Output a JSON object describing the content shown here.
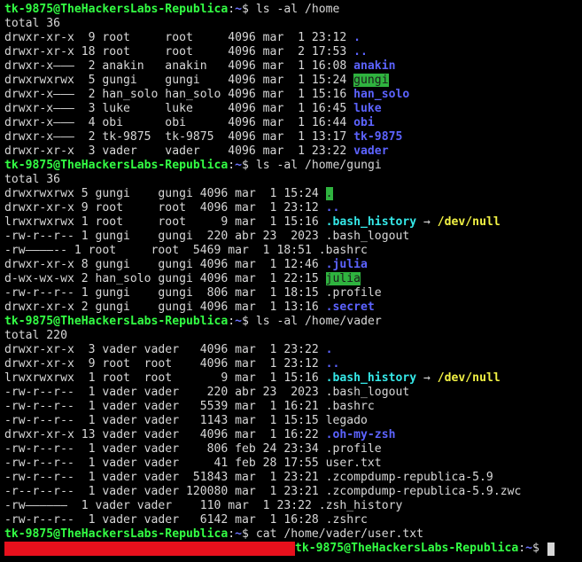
{
  "prompt": {
    "user": "tk-9875@TheHackersLabs-Republica",
    "sep": ":",
    "tilde": "~",
    "end": "$ "
  },
  "lines": [
    {
      "t": "prompt",
      "cmd": "ls -al /home"
    },
    {
      "t": "text",
      "text": "total 36"
    },
    {
      "t": "entry",
      "prefix": "drwxr-xr-x  9 root     root     4096 mar  1 23:12 ",
      "name": ".",
      "cls": "dir"
    },
    {
      "t": "entry",
      "prefix": "drwxr-xr-x 18 root     root     4096 mar  2 17:53 ",
      "name": "..",
      "cls": "dir"
    },
    {
      "t": "entry",
      "prefix": "drwxr-x———  2 anakin   anakin   4096 mar  1 16:08 ",
      "name": "anakin",
      "cls": "dir"
    },
    {
      "t": "entry",
      "prefix": "drwxrwxrwx  5 gungi    gungi    4096 mar  1 15:24 ",
      "name": "gungi",
      "cls": "ow"
    },
    {
      "t": "entry",
      "prefix": "drwxr-x———  2 han_solo han_solo 4096 mar  1 15:16 ",
      "name": "han_solo",
      "cls": "dir"
    },
    {
      "t": "entry",
      "prefix": "drwxr-x———  3 luke     luke     4096 mar  1 16:45 ",
      "name": "luke",
      "cls": "dir"
    },
    {
      "t": "entry",
      "prefix": "drwxr-x———  4 obi      obi      4096 mar  1 16:44 ",
      "name": "obi",
      "cls": "dir"
    },
    {
      "t": "entry",
      "prefix": "drwxr-x———  2 tk-9875  tk-9875  4096 mar  1 13:17 ",
      "name": "tk-9875",
      "cls": "dir"
    },
    {
      "t": "entry",
      "prefix": "drwxr-xr-x  3 vader    vader    4096 mar  1 23:22 ",
      "name": "vader",
      "cls": "dir"
    },
    {
      "t": "prompt",
      "cmd": "ls -al /home/gungi"
    },
    {
      "t": "text",
      "text": "total 36"
    },
    {
      "t": "entry",
      "prefix": "drwxrwxrwx 5 gungi    gungi 4096 mar  1 15:24 ",
      "name": ".",
      "cls": "ow"
    },
    {
      "t": "entry",
      "prefix": "drwxr-xr-x 9 root     root  4096 mar  1 23:12 ",
      "name": "..",
      "cls": "dir"
    },
    {
      "t": "link",
      "prefix": "lrwxrwxrwx 1 root     root     9 mar  1 15:16 ",
      "name": ".bash_history",
      "arrow": " → ",
      "target": "/dev/null"
    },
    {
      "t": "entry",
      "prefix": "-rw-r--r-- 1 gungi    gungi  220 abr 23  2023 ",
      "name": ".bash_logout",
      "cls": "plain"
    },
    {
      "t": "entry",
      "prefix": "-rw————-- 1 root     root  5469 mar  1 18:51 ",
      "name": ".bashrc",
      "cls": "plain"
    },
    {
      "t": "entry",
      "prefix": "drwxr-xr-x 8 gungi    gungi 4096 mar  1 12:46 ",
      "name": ".julia",
      "cls": "dir"
    },
    {
      "t": "entry",
      "prefix": "d-wx-wx-wx 2 han_solo gungi 4096 mar  1 22:15 ",
      "name": "julia",
      "cls": "ow"
    },
    {
      "t": "entry",
      "prefix": "-rw-r--r-- 1 gungi    gungi  806 mar  1 18:15 ",
      "name": ".profile",
      "cls": "plain"
    },
    {
      "t": "entry",
      "prefix": "drwxr-xr-x 2 gungi    gungi 4096 mar  1 13:16 ",
      "name": ".secret",
      "cls": "dir"
    },
    {
      "t": "prompt",
      "cmd": "ls -al /home/vader"
    },
    {
      "t": "text",
      "text": "total 220"
    },
    {
      "t": "entry",
      "prefix": "drwxr-xr-x  3 vader vader   4096 mar  1 23:22 ",
      "name": ".",
      "cls": "dir"
    },
    {
      "t": "entry",
      "prefix": "drwxr-xr-x  9 root  root    4096 mar  1 23:12 ",
      "name": "..",
      "cls": "dir"
    },
    {
      "t": "link",
      "prefix": "lrwxrwxrwx  1 root  root       9 mar  1 15:16 ",
      "name": ".bash_history",
      "arrow": " → ",
      "target": "/dev/null"
    },
    {
      "t": "entry",
      "prefix": "-rw-r--r--  1 vader vader    220 abr 23  2023 ",
      "name": ".bash_logout",
      "cls": "plain"
    },
    {
      "t": "entry",
      "prefix": "-rw-r--r--  1 vader vader   5539 mar  1 16:21 ",
      "name": ".bashrc",
      "cls": "plain"
    },
    {
      "t": "entry",
      "prefix": "-rw-r--r--  1 vader vader   1143 mar  1 15:15 ",
      "name": "legado",
      "cls": "plain"
    },
    {
      "t": "entry",
      "prefix": "drwxr-xr-x 13 vader vader   4096 mar  1 16:22 ",
      "name": ".oh-my-zsh",
      "cls": "dir"
    },
    {
      "t": "entry",
      "prefix": "-rw-r--r--  1 vader vader    806 feb 24 23:34 ",
      "name": ".profile",
      "cls": "plain"
    },
    {
      "t": "entry",
      "prefix": "-rw-r--r--  1 vader vader     41 feb 28 17:55 ",
      "name": "user.txt",
      "cls": "plain"
    },
    {
      "t": "entry",
      "prefix": "-rw-r--r--  1 vader vader  51843 mar  1 23:21 ",
      "name": ".zcompdump-republica-5.9",
      "cls": "plain"
    },
    {
      "t": "entry",
      "prefix": "-r--r--r--  1 vader vader 120080 mar  1 23:21 ",
      "name": ".zcompdump-republica-5.9.zwc",
      "cls": "plain"
    },
    {
      "t": "entry",
      "prefix": "-rw——————  1 vader vader    110 mar  1 23:22 ",
      "name": ".zsh_history",
      "cls": "plain"
    },
    {
      "t": "entry",
      "prefix": "-rw-r--r--  1 vader vader   6142 mar  1 16:28 ",
      "name": ".zshrc",
      "cls": "plain"
    },
    {
      "t": "prompt",
      "cmd": "cat /home/vader/user.txt"
    },
    {
      "t": "redacted_prompt"
    }
  ],
  "colors": {
    "prompt_user": "#33ff44",
    "prompt_path": "#6b72ff",
    "directory": "#5c63ff",
    "other_writable_bg": "#2fb33f",
    "symlink": "#35e8e8",
    "symlink_target": "#f2f244",
    "redaction": "#e8101c"
  }
}
